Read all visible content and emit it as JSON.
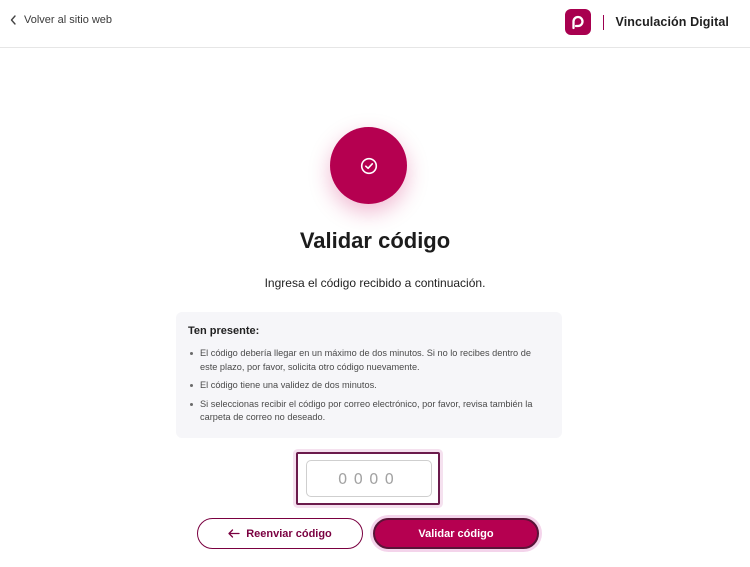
{
  "header": {
    "back_label": "Volver al sitio web",
    "brand_name": "Vinculación Digital"
  },
  "main": {
    "title": "Validar código",
    "subtitle": "Ingresa el código recibido a continuación."
  },
  "notice": {
    "title": "Ten presente:",
    "items": [
      "El código debería llegar en un máximo de dos minutos. Si no lo recibes dentro de este plazo, por favor, solicita otro código nuevamente.",
      "El código tiene una validez de dos minutos.",
      "Si seleccionas recibir el código por correo electrónico, por favor, revisa también la carpeta de correo no deseado."
    ]
  },
  "code_field": {
    "placeholder": "0000",
    "value": ""
  },
  "buttons": {
    "resend_label": "Reenviar código",
    "validate_label": "Validar código"
  },
  "icons": {
    "back": "chevron-left-icon",
    "logo": "brand-logo-icon",
    "hero": "check-circle-icon",
    "resend": "arrow-left-icon"
  },
  "colors": {
    "brand": "#b50050",
    "brand_dark": "#7a0040",
    "notice_bg": "#f6f6f9"
  }
}
